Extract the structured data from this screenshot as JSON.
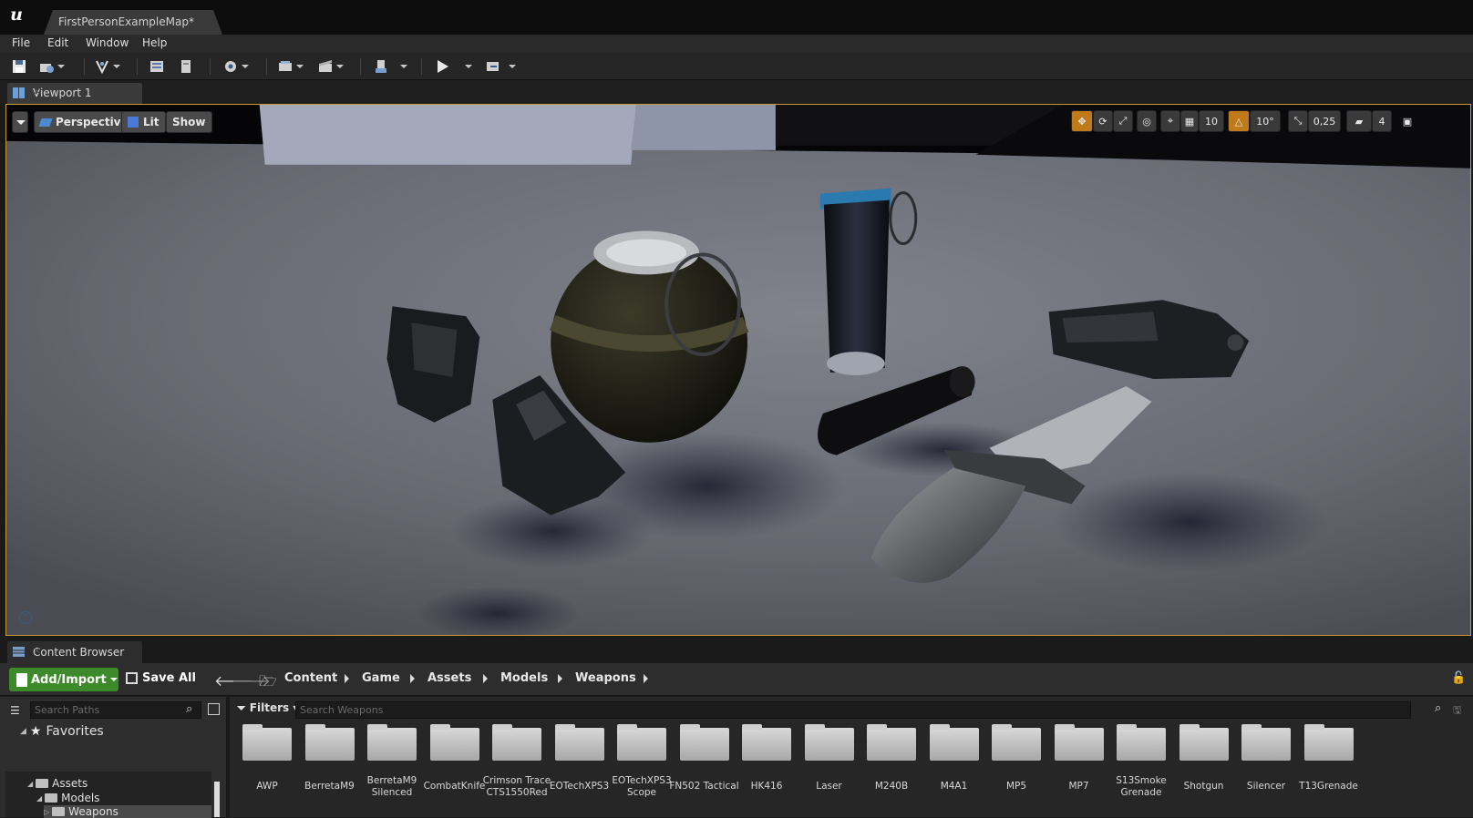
{
  "window": {
    "doc_tab_title": "FirstPersonExampleMap*"
  },
  "menu": [
    "File",
    "Edit",
    "Window",
    "Help"
  ],
  "viewport": {
    "tab_label": "Viewport 1",
    "view_mode": "Perspective",
    "lighting": "Lit",
    "show": "Show",
    "grid_snap": "10",
    "rotation_snap": "10°",
    "scale_snap": "0,25",
    "camera_speed": "4"
  },
  "content_browser": {
    "tab_label": "Content Browser",
    "add_import": "Add/Import",
    "save_all": "Save All",
    "breadcrumbs": [
      "Content",
      "Game",
      "Assets",
      "Models",
      "Weapons"
    ],
    "search_paths_placeholder": "Search Paths",
    "filters": "Filters",
    "search_assets_placeholder": "Search Weapons",
    "favorites": "Favorites",
    "tree": [
      "Assets",
      "Models",
      "Weapons"
    ],
    "assets": [
      "AWP",
      "BerretaM9",
      "BerretaM9 Silenced",
      "CombatKnife",
      "Crimson Trace CTS1550Red",
      "EOTechXPS3",
      "EOTechXPS3 Scope",
      "FN502 Tactical",
      "HK416",
      "Laser",
      "M240B",
      "M4A1",
      "MP5",
      "MP7",
      "S13Smoke Grenade",
      "Shotgun",
      "Silencer",
      "T13Grenade"
    ]
  },
  "colors": {
    "accent_orange": "#c59a36",
    "add_green": "#3d8a2a",
    "viewport_gray": "#6d6f78"
  }
}
